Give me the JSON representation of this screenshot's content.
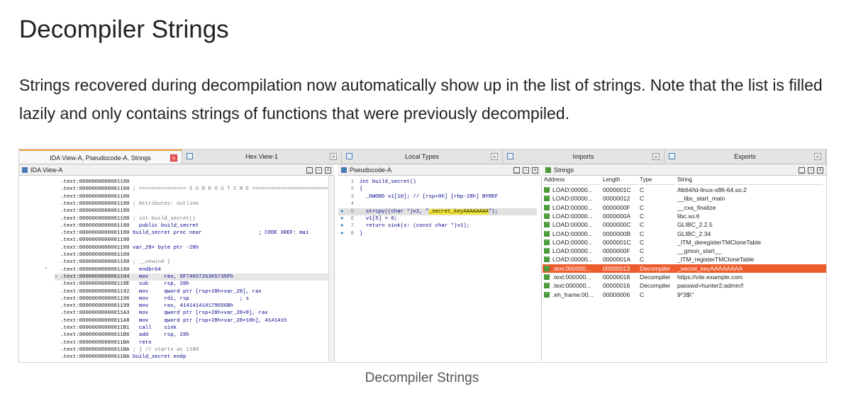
{
  "article": {
    "title": "Decompiler Strings",
    "paragraph": "Strings recovered during decompilation now automatically show up in the list of strings. Note that the list is filled lazily and only contains strings of functions that were previously decompiled.",
    "caption": "Decompiler Strings"
  },
  "tabs": [
    {
      "label": "IDA View-A, Pseudocode-A, Strings",
      "active": true
    },
    {
      "label": "Hex View-1",
      "active": false
    },
    {
      "label": "Local Types",
      "active": false
    },
    {
      "label": "Imports",
      "active": false
    },
    {
      "label": "Exports",
      "active": false
    }
  ],
  "panels": {
    "ida_title": "IDA View-A",
    "pseudo_title": "Pseudocode-A",
    "strings_title": "Strings"
  },
  "ida_lines": [
    {
      "addr": ".text:0000000000001180",
      "rest": ""
    },
    {
      "addr": ".text:0000000000001180",
      "rest": " ; =============== S U B R O U T I N E ======================================"
    },
    {
      "addr": ".text:0000000000001180",
      "rest": ""
    },
    {
      "addr": ".text:0000000000001180",
      "rest": " ; Attributes: outline"
    },
    {
      "addr": ".text:0000000000001180",
      "rest": ""
    },
    {
      "addr": ".text:0000000000001180",
      "rest": " ; int build_secret()"
    },
    {
      "addr": ".text:0000000000001180",
      "rest": "   public build_secret"
    },
    {
      "addr": ".text:0000000000001180",
      "rest": " build_secret proc near                  ; CODE XREF: mai"
    },
    {
      "addr": ".text:0000000000001180",
      "rest": ""
    },
    {
      "addr": ".text:0000000000001180",
      "rest": " var_28= byte ptr -28h"
    },
    {
      "addr": ".text:0000000000001180",
      "rest": ""
    },
    {
      "addr": ".text:0000000000001180",
      "rest": " ; __unwind {"
    },
    {
      "addr": ".text:0000000000001180",
      "rest": "   endbr64"
    },
    {
      "addr": ".text:0000000000001184",
      "rest": "   mov     rax, 5F7465726365735Fh"
    },
    {
      "addr": ".text:000000000000118E",
      "rest": "   sub     rsp, 28h"
    },
    {
      "addr": ".text:0000000000001192",
      "rest": "   mov     qword ptr [rsp+28h+var_28], rax"
    },
    {
      "addr": ".text:0000000000001196",
      "rest": "   mov     rdi, rsp                ; s"
    },
    {
      "addr": ".text:0000000000001199",
      "rest": "   mov     rax, 414141414179656Bh"
    },
    {
      "addr": ".text:00000000000011A3",
      "rest": "   mov     qword ptr [rsp+28h+var_28+8], rax"
    },
    {
      "addr": ".text:00000000000011A8",
      "rest": "   mov     qword ptr [rsp+28h+var_28+10h], 414141h"
    },
    {
      "addr": ".text:00000000000011B1",
      "rest": "   call    sink"
    },
    {
      "addr": ".text:00000000000011B6",
      "rest": "   add     rsp, 28h"
    },
    {
      "addr": ".text:00000000000011BA",
      "rest": "   retn"
    },
    {
      "addr": ".text:00000000000011BA",
      "rest": " ; } // starts at 1180"
    },
    {
      "addr": ".text:00000000000011BA",
      "rest": " build_secret endp"
    }
  ],
  "pseudo_lines": [
    {
      "n": "1",
      "code": "int build_secret()"
    },
    {
      "n": "2",
      "code": "{"
    },
    {
      "n": "3",
      "code": "  _DWORD v1[10]; // [rsp+0h] [rbp-28h] BYREF"
    },
    {
      "n": "4",
      "code": ""
    },
    {
      "n": "5",
      "code": "  strcpy((char *)v1, \"",
      "str": "_secret_keyAAAAAAAA",
      "tail": "\");"
    },
    {
      "n": "6",
      "code": "  v1[5] = 0;"
    },
    {
      "n": "7",
      "code": "  return sink(s: (const char *)v1);"
    },
    {
      "n": "8",
      "code": "}"
    }
  ],
  "strings": {
    "headers": [
      "Address",
      "Length",
      "Type",
      "String"
    ],
    "rows": [
      [
        "LOAD:00000...",
        "0000001C",
        "C",
        "/lib64/ld-linux-x86-64.so.2"
      ],
      [
        "LOAD:00000...",
        "00000012",
        "C",
        "__libc_start_main"
      ],
      [
        "LOAD:00000...",
        "0000000F",
        "C",
        "__cxa_finalize"
      ],
      [
        "LOAD:00000...",
        "0000000A",
        "C",
        "libc.so.6"
      ],
      [
        "LOAD:00000...",
        "0000000C",
        "C",
        "GLIBC_2.2.5"
      ],
      [
        "LOAD:00000...",
        "0000000B",
        "C",
        "GLIBC_2.34"
      ],
      [
        "LOAD:00000...",
        "0000001C",
        "C",
        "_ITM_deregisterTMCloneTable"
      ],
      [
        "LOAD:00000...",
        "0000000F",
        "C",
        "__gmon_start__"
      ],
      [
        "LOAD:00000...",
        "0000001A",
        "C",
        "_ITM_registerTMCloneTable"
      ],
      [
        ".text:000000...",
        "00000013",
        "Decompiler",
        "_secret_keyAAAAAAAA"
      ],
      [
        ".text:000000...",
        "00000018",
        "Decompiler",
        "https://vile.example.com"
      ],
      [
        ".text:000000...",
        "00000016",
        "Decompiler",
        "passwd=hunter2;admin!!"
      ],
      [
        ".eh_frame:00...",
        "00000006",
        "C",
        "9*3$\\\""
      ]
    ],
    "selected_index": 9
  },
  "colors": {
    "selected_row": "#ee5b2c",
    "highlight": "#f2e63a",
    "accent_tab": "#f0a040"
  }
}
